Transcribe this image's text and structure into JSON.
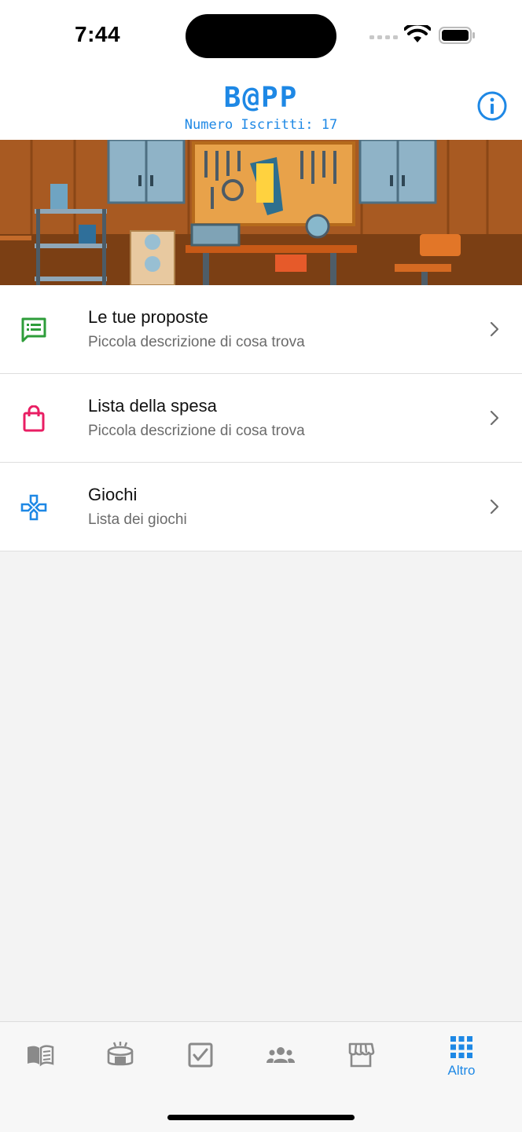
{
  "status_bar": {
    "time": "7:44"
  },
  "header": {
    "logo": "B@PP",
    "subscribers": "Numero Iscritti: 17",
    "info_icon": "info-circle-icon"
  },
  "menu": [
    {
      "title": "Le tue proposte",
      "description": "Piccola descrizione di cosa trova",
      "icon": "proposals-chat-icon",
      "icon_color": "#2e9d3a"
    },
    {
      "title": "Lista della spesa",
      "description": "Piccola descrizione di cosa trova",
      "icon": "shopping-bag-icon",
      "icon_color": "#e91e63"
    },
    {
      "title": "Giochi",
      "description": "Lista dei giochi",
      "icon": "gamepad-icon",
      "icon_color": "#1e88e5"
    }
  ],
  "tab_bar": {
    "tabs": [
      {
        "icon": "book-icon",
        "label": ""
      },
      {
        "icon": "stadium-icon",
        "label": ""
      },
      {
        "icon": "checkbox-icon",
        "label": ""
      },
      {
        "icon": "group-icon",
        "label": ""
      },
      {
        "icon": "store-icon",
        "label": ""
      },
      {
        "icon": "grid-icon",
        "label": "Altro",
        "active": true
      }
    ],
    "active_color": "#1e88e5",
    "inactive_color": "#8a8a8a"
  }
}
